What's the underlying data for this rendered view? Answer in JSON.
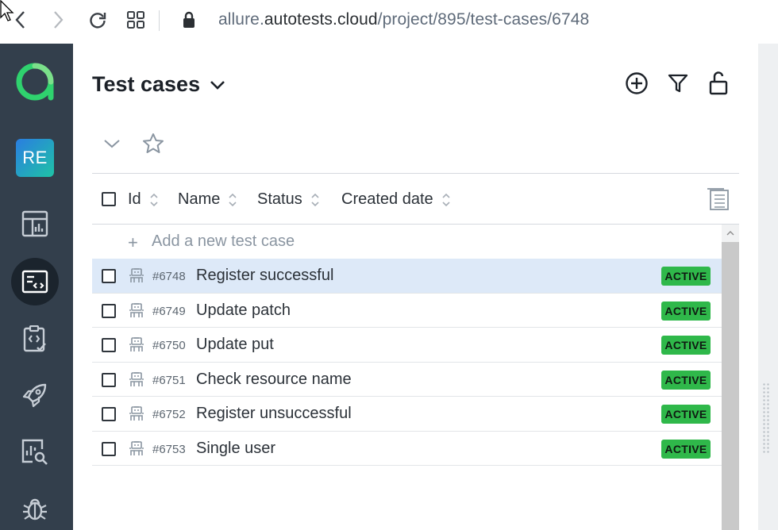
{
  "browser": {
    "url_prefix": "allure.",
    "url_domain": "autotests.cloud",
    "url_path": "/project/895/test-cases/6748"
  },
  "sidebar": {
    "avatar_initials": "RE",
    "brand_color": "#2fd26e",
    "items": [
      {
        "name": "dashboard",
        "icon": "dashboard-icon",
        "active": false
      },
      {
        "name": "test-cases",
        "icon": "test-cases-icon",
        "active": true
      },
      {
        "name": "test-plans",
        "icon": "clipboard-code-icon",
        "active": false
      },
      {
        "name": "launches",
        "icon": "rocket-icon",
        "active": false
      },
      {
        "name": "analytics",
        "icon": "chart-search-icon",
        "active": false
      },
      {
        "name": "defects",
        "icon": "bug-icon",
        "active": false
      }
    ]
  },
  "header": {
    "title": "Test cases"
  },
  "table": {
    "columns": [
      "Id",
      "Name",
      "Status",
      "Created date"
    ],
    "add_placeholder": "Add a new test case",
    "rows": [
      {
        "id": "#6748",
        "name": "Register successful",
        "status": "ACTIVE",
        "selected": true
      },
      {
        "id": "#6749",
        "name": "Update patch",
        "status": "ACTIVE",
        "selected": false
      },
      {
        "id": "#6750",
        "name": "Update put",
        "status": "ACTIVE",
        "selected": false
      },
      {
        "id": "#6751",
        "name": "Check resource name",
        "status": "ACTIVE",
        "selected": false
      },
      {
        "id": "#6752",
        "name": "Register unsuccessful",
        "status": "ACTIVE",
        "selected": false
      },
      {
        "id": "#6753",
        "name": "Single user",
        "status": "ACTIVE",
        "selected": false
      }
    ]
  },
  "colors": {
    "sidebar_bg": "#333f4c",
    "active_badge": "#2fb84a",
    "selected_row": "#dde9f8"
  }
}
